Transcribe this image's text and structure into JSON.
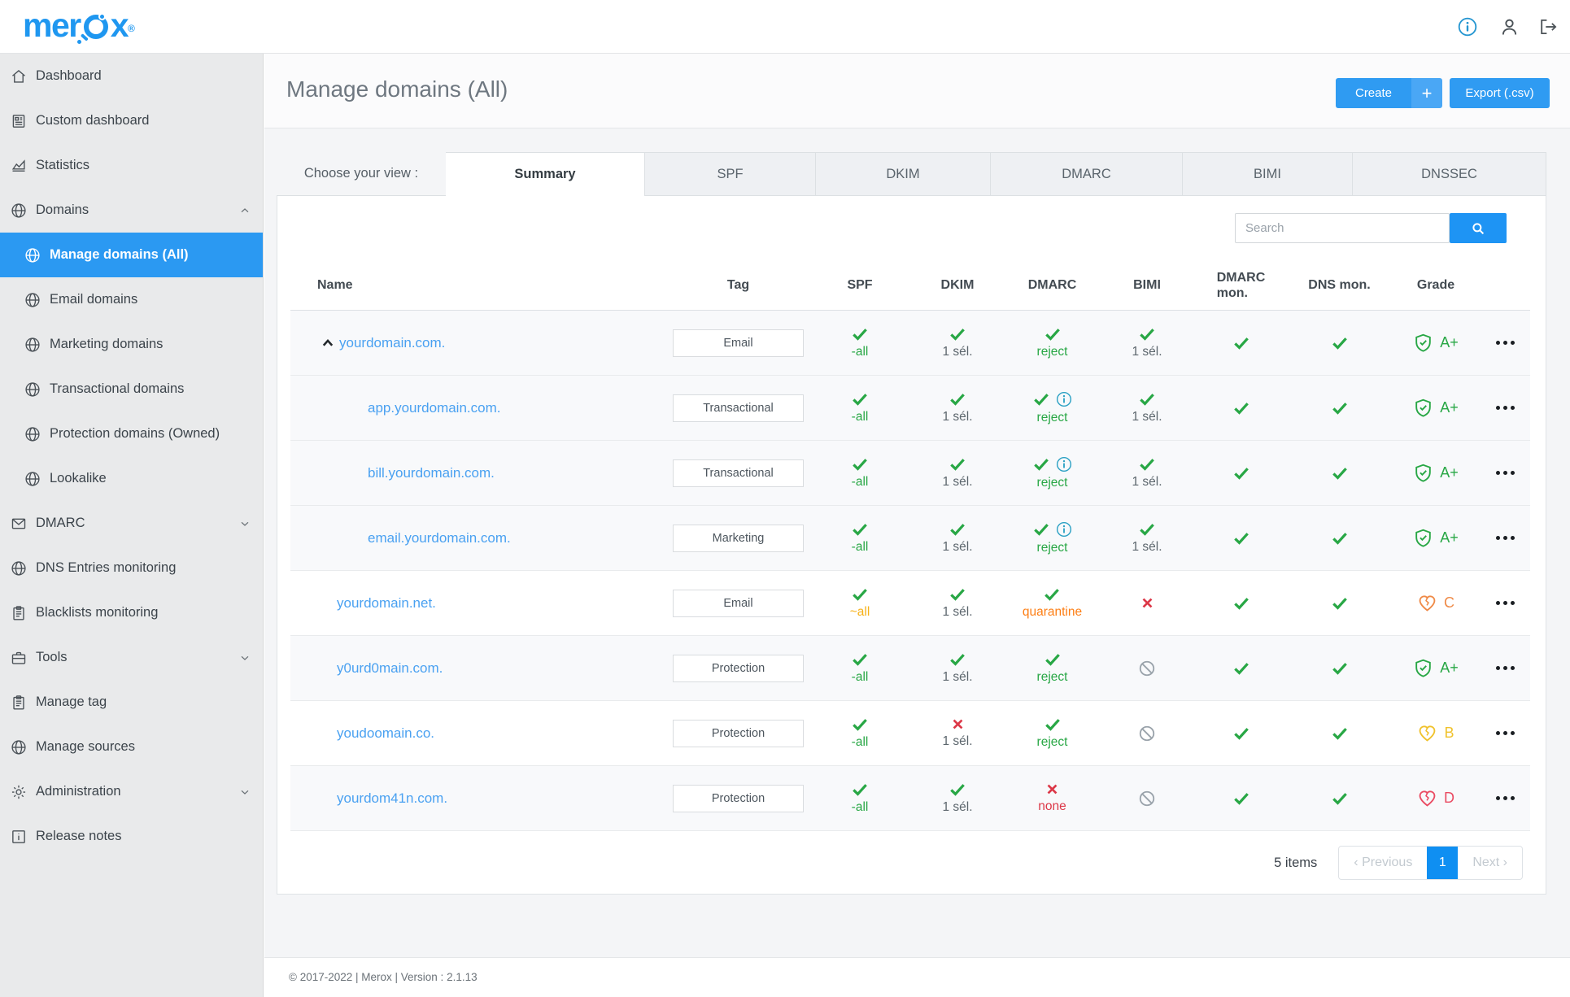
{
  "header": {
    "logo_part1": "mer",
    "logo_part2": "x",
    "registered": "®"
  },
  "sidebar": {
    "items": [
      {
        "label": "Dashboard",
        "icon": "home-icon",
        "sub": false,
        "active": false,
        "chevron": null
      },
      {
        "label": "Custom dashboard",
        "icon": "document-icon",
        "sub": false,
        "active": false,
        "chevron": null
      },
      {
        "label": "Statistics",
        "icon": "chart-icon",
        "sub": false,
        "active": false,
        "chevron": null
      },
      {
        "label": "Domains",
        "icon": "globe-icon",
        "sub": false,
        "active": false,
        "chevron": "up"
      },
      {
        "label": "Manage domains (All)",
        "icon": "globe-icon",
        "sub": true,
        "active": true,
        "chevron": null
      },
      {
        "label": "Email domains",
        "icon": "globe-icon",
        "sub": true,
        "active": false,
        "chevron": null
      },
      {
        "label": "Marketing domains",
        "icon": "globe-icon",
        "sub": true,
        "active": false,
        "chevron": null
      },
      {
        "label": "Transactional domains",
        "icon": "globe-icon",
        "sub": true,
        "active": false,
        "chevron": null
      },
      {
        "label": "Protection domains (Owned)",
        "icon": "globe-icon",
        "sub": true,
        "active": false,
        "chevron": null
      },
      {
        "label": "Lookalike",
        "icon": "globe-icon",
        "sub": true,
        "active": false,
        "chevron": null
      },
      {
        "label": "DMARC",
        "icon": "mail-icon",
        "sub": false,
        "active": false,
        "chevron": "down"
      },
      {
        "label": "DNS Entries monitoring",
        "icon": "globe-icon",
        "sub": false,
        "active": false,
        "chevron": null
      },
      {
        "label": "Blacklists monitoring",
        "icon": "clipboard-icon",
        "sub": false,
        "active": false,
        "chevron": null
      },
      {
        "label": "Tools",
        "icon": "toolbox-icon",
        "sub": false,
        "active": false,
        "chevron": "down"
      },
      {
        "label": "Manage tag",
        "icon": "clipboard-icon",
        "sub": false,
        "active": false,
        "chevron": null
      },
      {
        "label": "Manage sources",
        "icon": "globe-icon",
        "sub": false,
        "active": false,
        "chevron": null
      },
      {
        "label": "Administration",
        "icon": "gear-icon",
        "sub": false,
        "active": false,
        "chevron": "down"
      },
      {
        "label": "Release notes",
        "icon": "info-square-icon",
        "sub": false,
        "active": false,
        "chevron": null
      }
    ]
  },
  "page": {
    "title": "Manage domains (All)",
    "create_label": "Create",
    "create_plus": "+",
    "export_label": "Export (.csv)"
  },
  "tabs": {
    "caption": "Choose your view :",
    "items": [
      "Summary",
      "SPF",
      "DKIM",
      "DMARC",
      "BIMI",
      "DNSSEC"
    ],
    "active": "Summary"
  },
  "search": {
    "placeholder": "Search"
  },
  "table": {
    "columns": [
      "Name",
      "Tag",
      "SPF",
      "DKIM",
      "DMARC",
      "BIMI",
      "DMARC mon.",
      "DNS mon.",
      "Grade"
    ],
    "rows": [
      {
        "name": "yourdomain.com.",
        "caret": true,
        "indent": 0,
        "tag": "Email",
        "shaded": true,
        "spf": {
          "icon": "check",
          "label": "-all",
          "label_color": "green"
        },
        "dkim": {
          "icon": "check",
          "label": "1 sél.",
          "label_color": "gray"
        },
        "dmarc": {
          "icon": "check",
          "label": "reject",
          "label_color": "green",
          "info": false
        },
        "bimi": {
          "icon": "check",
          "label": "1 sél.",
          "label_color": "gray"
        },
        "dmarc_mon": {
          "icon": "check"
        },
        "dns_mon": {
          "icon": "check"
        },
        "grade": {
          "icon": "shield",
          "letter": "A+",
          "color": "green"
        }
      },
      {
        "name": "app.yourdomain.com.",
        "caret": false,
        "indent": 1,
        "tag": "Transactional",
        "shaded": true,
        "spf": {
          "icon": "check",
          "label": "-all",
          "label_color": "green"
        },
        "dkim": {
          "icon": "check",
          "label": "1 sél.",
          "label_color": "gray"
        },
        "dmarc": {
          "icon": "check",
          "label": "reject",
          "label_color": "green",
          "info": true
        },
        "bimi": {
          "icon": "check",
          "label": "1 sél.",
          "label_color": "gray"
        },
        "dmarc_mon": {
          "icon": "check"
        },
        "dns_mon": {
          "icon": "check"
        },
        "grade": {
          "icon": "shield",
          "letter": "A+",
          "color": "green"
        }
      },
      {
        "name": "bill.yourdomain.com.",
        "caret": false,
        "indent": 1,
        "tag": "Transactional",
        "shaded": true,
        "spf": {
          "icon": "check",
          "label": "-all",
          "label_color": "green"
        },
        "dkim": {
          "icon": "check",
          "label": "1 sél.",
          "label_color": "gray"
        },
        "dmarc": {
          "icon": "check",
          "label": "reject",
          "label_color": "green",
          "info": true
        },
        "bimi": {
          "icon": "check",
          "label": "1 sél.",
          "label_color": "gray"
        },
        "dmarc_mon": {
          "icon": "check"
        },
        "dns_mon": {
          "icon": "check"
        },
        "grade": {
          "icon": "shield",
          "letter": "A+",
          "color": "green"
        }
      },
      {
        "name": "email.yourdomain.com.",
        "caret": false,
        "indent": 1,
        "tag": "Marketing",
        "shaded": true,
        "spf": {
          "icon": "check",
          "label": "-all",
          "label_color": "green"
        },
        "dkim": {
          "icon": "check",
          "label": "1 sél.",
          "label_color": "gray"
        },
        "dmarc": {
          "icon": "check",
          "label": "reject",
          "label_color": "green",
          "info": true
        },
        "bimi": {
          "icon": "check",
          "label": "1 sél.",
          "label_color": "gray"
        },
        "dmarc_mon": {
          "icon": "check"
        },
        "dns_mon": {
          "icon": "check"
        },
        "grade": {
          "icon": "shield",
          "letter": "A+",
          "color": "green"
        }
      },
      {
        "name": "yourdomain.net.",
        "caret": false,
        "indent": 0,
        "tag": "Email",
        "shaded": false,
        "spf": {
          "icon": "check",
          "label": "~all",
          "label_color": "amber"
        },
        "dkim": {
          "icon": "check",
          "label": "1 sél.",
          "label_color": "gray"
        },
        "dmarc": {
          "icon": "check",
          "label": "quarantine",
          "label_color": "orange",
          "info": false
        },
        "bimi": {
          "icon": "x"
        },
        "dmarc_mon": {
          "icon": "check"
        },
        "dns_mon": {
          "icon": "check"
        },
        "grade": {
          "icon": "heart",
          "letter": "C",
          "color": "orange"
        }
      },
      {
        "name": "y0urd0main.com.",
        "caret": false,
        "indent": 0,
        "tag": "Protection",
        "shaded": true,
        "spf": {
          "icon": "check",
          "label": "-all",
          "label_color": "green"
        },
        "dkim": {
          "icon": "check",
          "label": "1 sél.",
          "label_color": "gray"
        },
        "dmarc": {
          "icon": "check",
          "label": "reject",
          "label_color": "green",
          "info": false
        },
        "bimi": {
          "icon": "block"
        },
        "dmarc_mon": {
          "icon": "check"
        },
        "dns_mon": {
          "icon": "check"
        },
        "grade": {
          "icon": "shield",
          "letter": "A+",
          "color": "green"
        }
      },
      {
        "name": "youdoomain.co.",
        "caret": false,
        "indent": 0,
        "tag": "Protection",
        "shaded": false,
        "spf": {
          "icon": "check",
          "label": "-all",
          "label_color": "green"
        },
        "dkim": {
          "icon": "x",
          "label": "1 sél.",
          "label_color": "gray"
        },
        "dmarc": {
          "icon": "check",
          "label": "reject",
          "label_color": "green",
          "info": false
        },
        "bimi": {
          "icon": "block"
        },
        "dmarc_mon": {
          "icon": "check"
        },
        "dns_mon": {
          "icon": "check"
        },
        "grade": {
          "icon": "heart",
          "letter": "B",
          "color": "yellow"
        }
      },
      {
        "name": "yourdom41n.com.",
        "caret": false,
        "indent": 0,
        "tag": "Protection",
        "shaded": true,
        "spf": {
          "icon": "check",
          "label": "-all",
          "label_color": "green"
        },
        "dkim": {
          "icon": "check",
          "label": "1 sél.",
          "label_color": "gray"
        },
        "dmarc": {
          "icon": "x",
          "label": "none",
          "label_color": "red",
          "info": false
        },
        "bimi": {
          "icon": "block"
        },
        "dmarc_mon": {
          "icon": "check"
        },
        "dns_mon": {
          "icon": "check"
        },
        "grade": {
          "icon": "heart",
          "letter": "D",
          "color": "red"
        }
      }
    ]
  },
  "pagination": {
    "count_label": "5 items",
    "previous": "‹ Previous",
    "page": "1",
    "next": "Next ›"
  },
  "footer": {
    "text": "© 2017-2022 | Merox | Version : 2.1.13"
  }
}
